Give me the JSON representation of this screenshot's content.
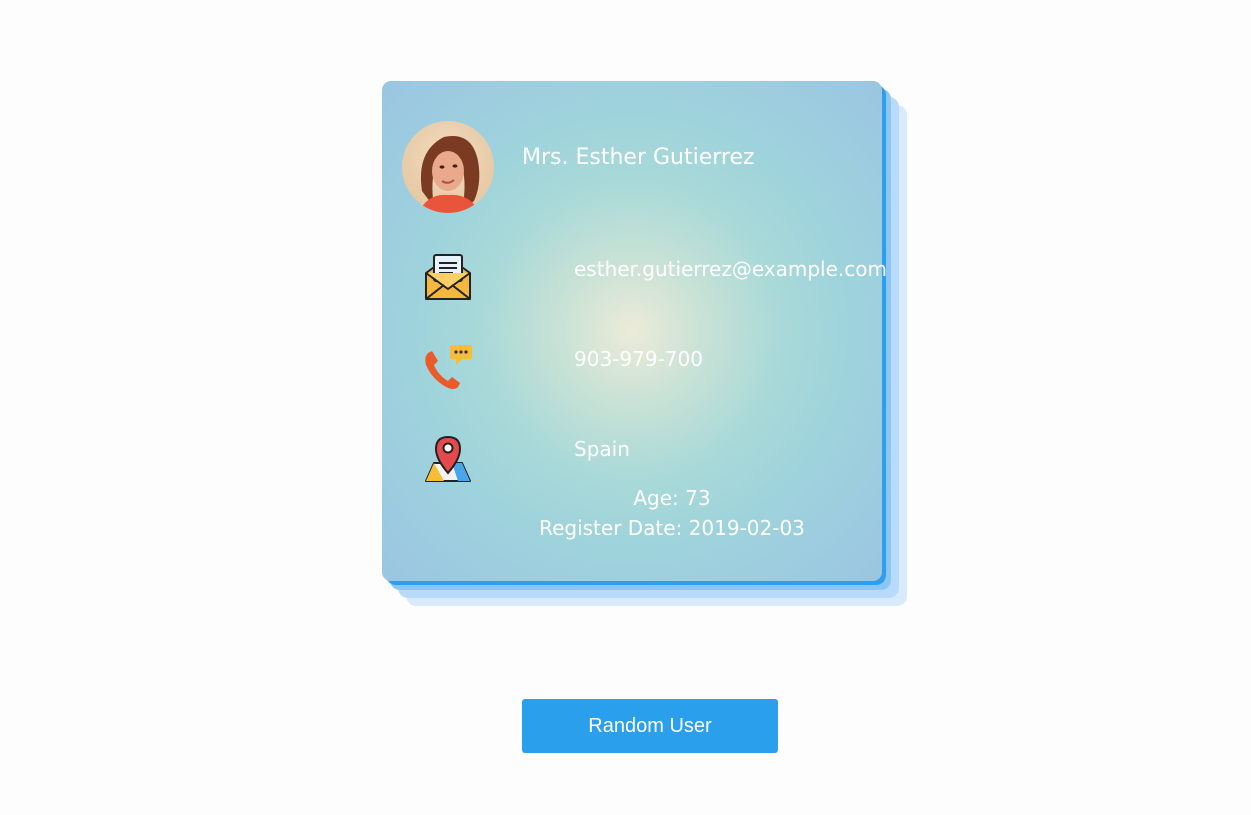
{
  "user": {
    "name": "Mrs. Esther Gutierrez",
    "email": "esther.gutierrez@example.com",
    "phone": "903-979-700",
    "country": "Spain",
    "age_text": "Age: 73",
    "register_text": "Register Date: 2019-02-03",
    "avatar_icon": "user-photo"
  },
  "icons": {
    "email": "envelope-icon",
    "phone": "phone-chat-icon",
    "location": "map-pin-icon"
  },
  "actions": {
    "random_label": "Random User"
  },
  "colors": {
    "card_border": "#2d9ef0",
    "button": "#2a9fec",
    "text": "#ffffff"
  }
}
